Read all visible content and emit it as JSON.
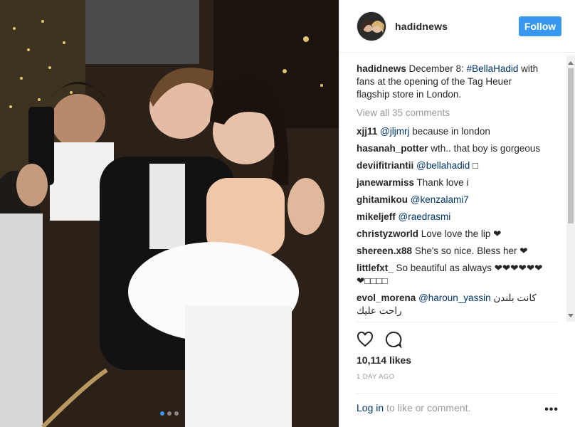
{
  "post": {
    "username": "hadidnews",
    "follow_label": "Follow",
    "caption": {
      "username": "hadidnews",
      "text_before": " December 8: ",
      "hashtag": "#BellaHadid",
      "text_after": " with fans at the opening of the Tag Heuer flagship store in London."
    },
    "view_all_label": "View all 35 comments",
    "comments": [
      {
        "user": "xjj11",
        "mention": "@jljmrj",
        "text": " because in london"
      },
      {
        "user": "hasanah_potter",
        "mention": "",
        "text": " wth.. that boy is gorgeous"
      },
      {
        "user": "deviifitriantii",
        "mention": "@bellahadid",
        "text": " □ "
      },
      {
        "user": "janewarmiss",
        "mention": "",
        "text": " Thank love i"
      },
      {
        "user": "ghitamikou",
        "mention": "@kenzalami7",
        "text": ""
      },
      {
        "user": "mikeljeff",
        "mention": "@raedrasmi",
        "text": ""
      },
      {
        "user": "christyzworld",
        "mention": "",
        "text": " Love love the lip ❤"
      },
      {
        "user": "shereen.x88",
        "mention": "",
        "text": " She's so nice. Bless her ❤"
      },
      {
        "user": "littlefxt_",
        "mention": "",
        "text": " So beautiful as always ❤❤❤❤❤❤ ❤□□□□"
      },
      {
        "user": "evol_morena",
        "mention": "@haroun_yassin",
        "text": " كانت بلندن راحت عليك"
      }
    ],
    "likes": "10,114 likes",
    "timestamp": "1 DAY AGO",
    "login_link": "Log in",
    "login_suffix": " to like or comment.",
    "more_label": "•••",
    "carousel": {
      "count": 3,
      "active": 0
    }
  },
  "colors": {
    "accent": "#3897f0",
    "link": "#003569",
    "muted": "#999999"
  },
  "icons": [
    "heart-icon",
    "comment-icon",
    "more-options-icon"
  ]
}
